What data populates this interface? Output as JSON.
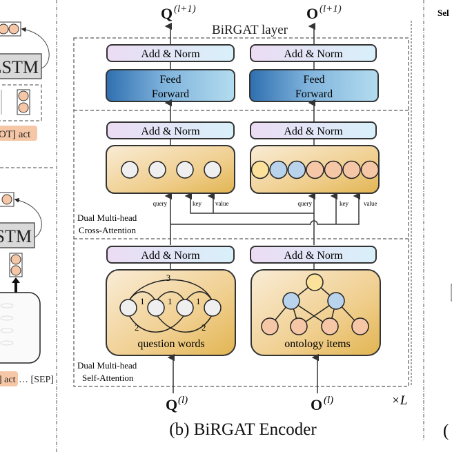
{
  "left_panel": {
    "lstm_top_label": "LSTM",
    "lstm_bottom_label": "STM",
    "token_row_top": "OT] act",
    "token_row_bottom_highlight": "] act",
    "token_row_bottom_rest": "… [SEP]"
  },
  "encoder": {
    "layer_title": "BiRGAT layer",
    "output_q": {
      "base": "Q",
      "sup": "(l+1)"
    },
    "output_o": {
      "base": "O",
      "sup": "(l+1)"
    },
    "input_q": {
      "base": "Q",
      "sup": "(l)"
    },
    "input_o": {
      "base": "O",
      "sup": "(l)"
    },
    "repeat_label": "×L",
    "caption": "(b) BiRGAT Encoder",
    "ffn_block": {
      "add_norm": "Add & Norm",
      "feed_forward_line1": "Feed",
      "feed_forward_line2": "Forward"
    },
    "cross_attention_block": {
      "add_norm": "Add & Norm",
      "label_line1": "Dual Multi-head",
      "label_line2": "Cross-Attention",
      "query_label": "query",
      "key_label": "key",
      "value_label": "value",
      "left_nodes": [
        "question",
        "question",
        "question",
        "question"
      ],
      "right_nodes": [
        "table",
        "column",
        "column",
        "value",
        "value",
        "value",
        "value"
      ]
    },
    "self_attention_block": {
      "add_norm": "Add & Norm",
      "label_line1": "Dual Multi-head",
      "label_line2": "Self-Attention",
      "question_caption": "question words",
      "ontology_caption": "ontology items",
      "edge_labels": {
        "top": "3",
        "adj1": "1",
        "adj2": "1",
        "adj3": "1",
        "skip_left": "2",
        "skip_right": "2"
      }
    }
  },
  "right_panel": {
    "top_text": "Sel",
    "caption_fragment": "("
  },
  "colors": {
    "node_grey": "#efefef",
    "node_yellow": "#fbe19a",
    "node_blue": "#b9d3ec",
    "node_orange": "#f6c7a6",
    "attention_box_light": "#f7e4c4",
    "attention_box_dark": "#e2b552",
    "ffn_dark": "#2f6fb0",
    "ffn_light": "#b3dcef",
    "addnorm_left": "#ecdcf3",
    "addnorm_right": "#d8f0fa",
    "lstm_fill": "#d9d9d9",
    "token_highlight": "#f6c7a6"
  }
}
